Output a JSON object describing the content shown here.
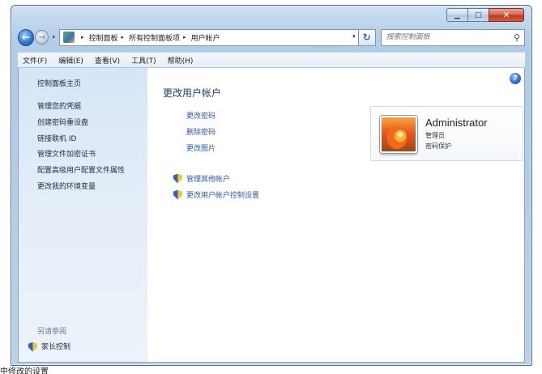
{
  "window": {
    "controls": {
      "minimize": "▁",
      "maximize": "□",
      "close": "✕"
    }
  },
  "nav": {
    "back_icon": "back-arrow-icon",
    "forward_icon": "forward-arrow-icon",
    "dropdown_glyph": "▾",
    "breadcrumb": [
      "控制面板",
      "所有控制面板项",
      "用户帐户"
    ],
    "separator": "▸",
    "refresh_glyph": "↻",
    "search_placeholder": "搜索控制面板",
    "search_glyph": "⚲"
  },
  "menu": [
    "文件(F)",
    "编辑(E)",
    "查看(V)",
    "工具(T)",
    "帮助(H)"
  ],
  "sidebar": {
    "home": "控制面板主页",
    "items": [
      "管理您的凭据",
      "创建密码重设盘",
      "链接联机 ID",
      "管理文件加密证书",
      "配置高级用户配置文件属性",
      "更改我的环境变量"
    ],
    "see_also_heading": "另请参阅",
    "see_also": [
      "家长控制"
    ]
  },
  "main": {
    "title": "更改用户帐户",
    "help_glyph": "?",
    "tasks": [
      "更改密码",
      "删除密码",
      "更改图片"
    ],
    "other_tasks": [
      "管理其他帐户",
      "更改用户帐户控制设置"
    ]
  },
  "user": {
    "name": "Administrator",
    "role": "管理员",
    "status": "密码保护"
  },
  "bottom_fragment": "中修改的设置"
}
